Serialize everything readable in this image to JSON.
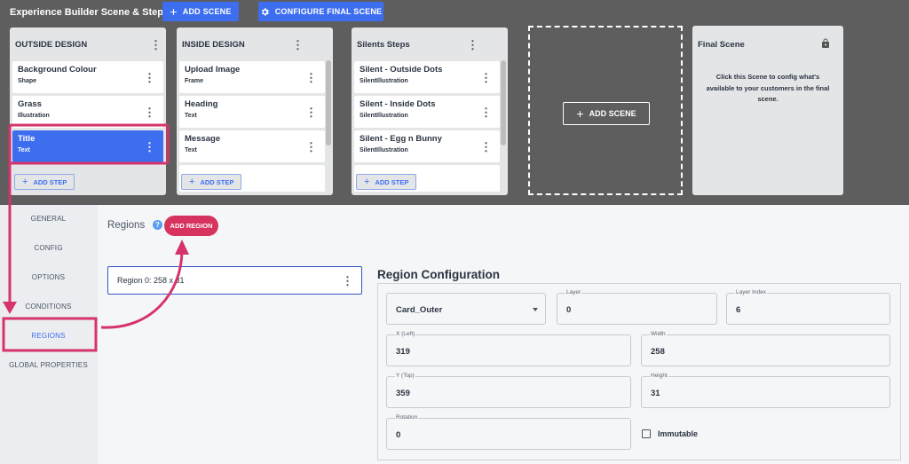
{
  "header": {
    "title": "Experience Builder Scene & Steps",
    "add_scene_label": "ADD SCENE",
    "configure_final_label": "CONFIGURE FINAL SCENE"
  },
  "scenes": [
    {
      "title": "OUTSIDE DESIGN",
      "steps": [
        {
          "name": "Background Colour",
          "type": "Shape"
        },
        {
          "name": "Grass",
          "type": "Illustration"
        },
        {
          "name": "Title",
          "type": "Text",
          "selected": true
        }
      ],
      "add_step_label": "ADD STEP"
    },
    {
      "title": "INSIDE DESIGN",
      "steps": [
        {
          "name": "Upload Image",
          "type": "Frame"
        },
        {
          "name": "Heading",
          "type": "Text"
        },
        {
          "name": "Message",
          "type": "Text"
        }
      ],
      "add_step_label": "ADD STEP"
    },
    {
      "title": "Silents Steps",
      "steps": [
        {
          "name": "Silent - Outside Dots",
          "type": "SilentIllustration"
        },
        {
          "name": "Silent - Inside Dots",
          "type": "SilentIllustration"
        },
        {
          "name": "Silent - Egg n Bunny",
          "type": "SilentIllustration"
        }
      ],
      "add_step_label": "ADD STEP"
    }
  ],
  "add_scene_placeholder": {
    "label": "ADD SCENE"
  },
  "final_scene": {
    "title": "Final Scene",
    "description": "Click this Scene to config what's available to your customers in the final scene."
  },
  "sidenav": {
    "items": [
      "GENERAL",
      "CONFIG",
      "OPTIONS",
      "CONDITIONS",
      "REGIONS",
      "GLOBAL PROPERTIES"
    ],
    "active": "REGIONS"
  },
  "regions": {
    "title": "Regions",
    "help_icon": "?",
    "add_region_label": "ADD REGION",
    "items": [
      {
        "label": "Region 0: 258 x 31"
      }
    ]
  },
  "region_config": {
    "title": "Region Configuration",
    "select_value": "Card_Outer",
    "layer": {
      "label": "Layer",
      "value": "0"
    },
    "layer_index": {
      "label": "Layer Index",
      "value": "6"
    },
    "x": {
      "label": "X (Left)",
      "value": "319"
    },
    "width": {
      "label": "Width",
      "value": "258"
    },
    "y": {
      "label": "Y (Top)",
      "value": "359"
    },
    "height": {
      "label": "Height",
      "value": "31"
    },
    "rotation": {
      "label": "Rotation",
      "value": "0"
    },
    "immutable_label": "Immutable"
  },
  "colors": {
    "primary": "#3d6ef0",
    "accent": "#d6335e",
    "top_bg": "#5e5e5e"
  }
}
